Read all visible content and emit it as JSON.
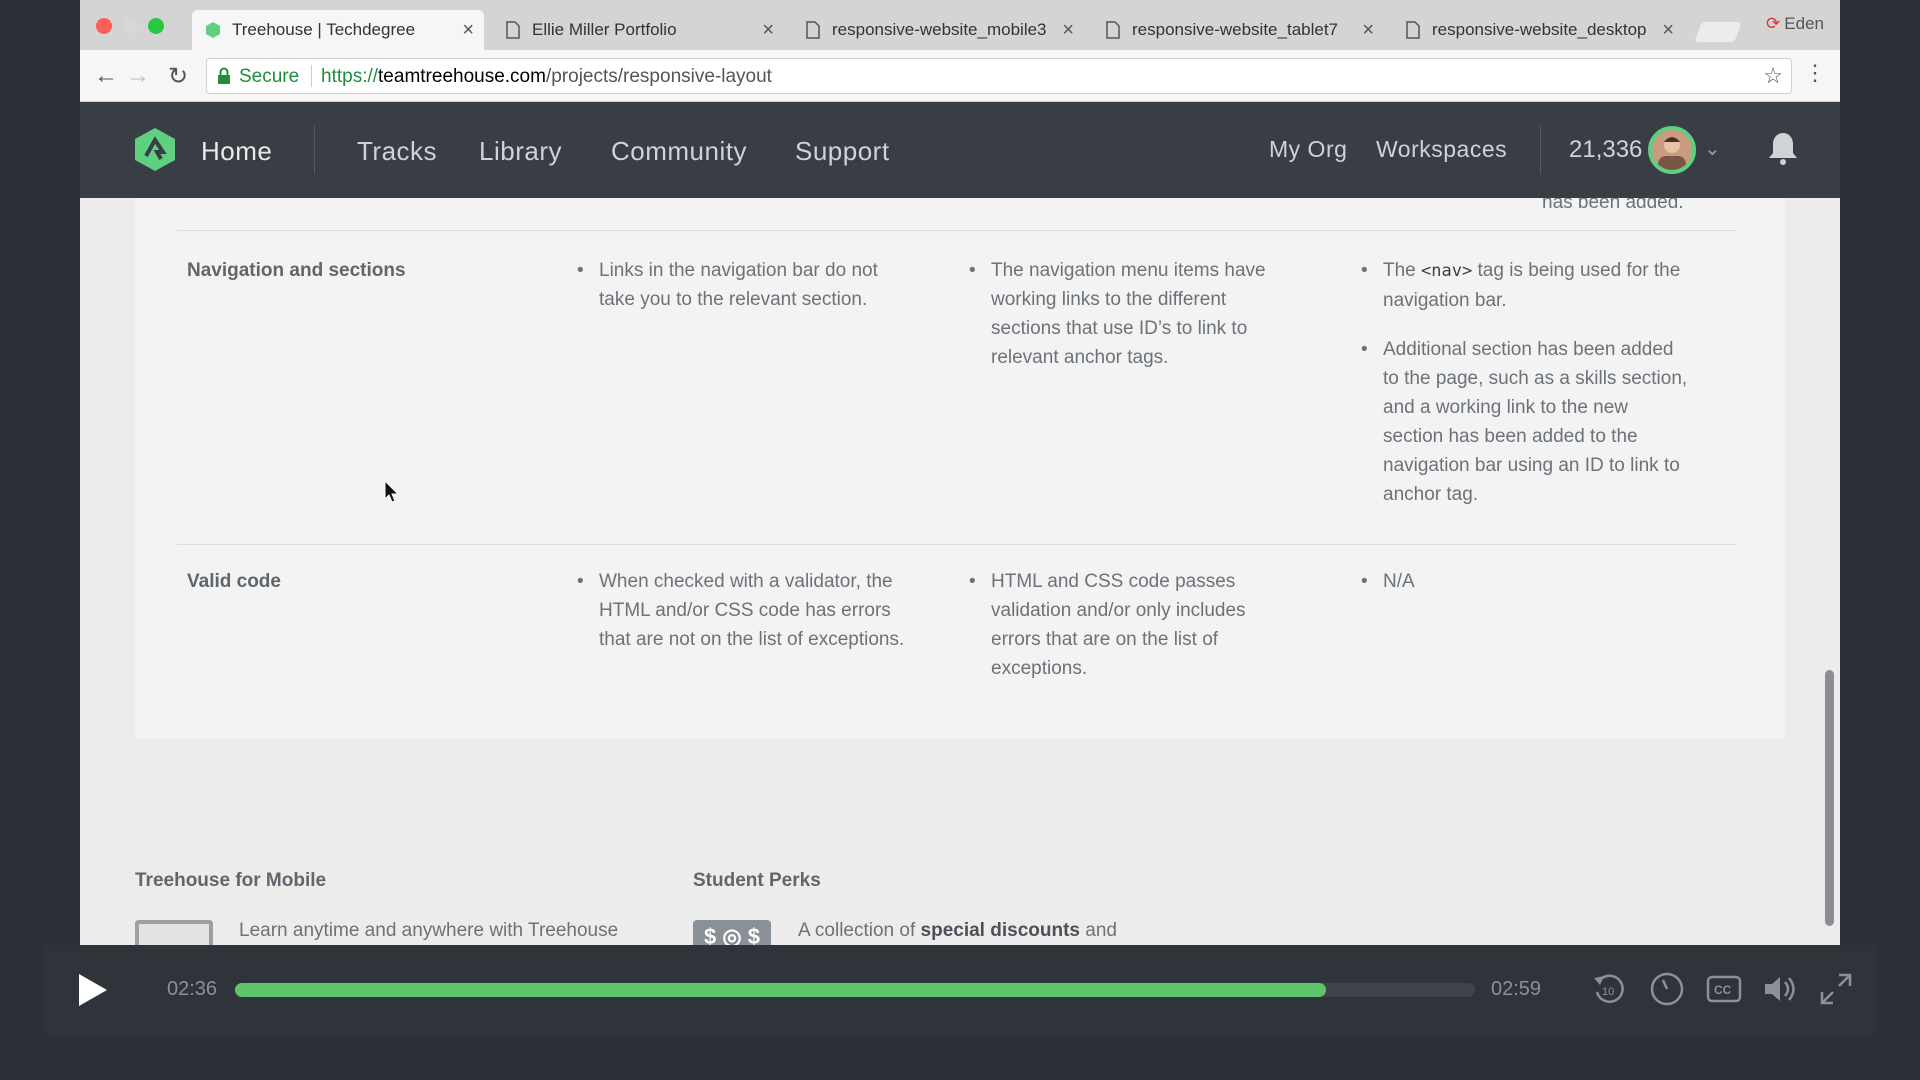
{
  "browser": {
    "tabs": [
      {
        "title": "Treehouse | Techdegree",
        "active": true
      },
      {
        "title": "Ellie Miller Portfolio",
        "active": false
      },
      {
        "title": "responsive-website_mobile3",
        "active": false
      },
      {
        "title": "responsive-website_tablet7",
        "active": false
      },
      {
        "title": "responsive-website_desktop",
        "active": false
      }
    ],
    "profile_name": "Eden",
    "address": {
      "secure_label": "Secure",
      "scheme": "https://",
      "host": "teamtreehouse.com",
      "path": "/projects/responsive-layout"
    }
  },
  "site_header": {
    "nav": {
      "home": "Home",
      "tracks": "Tracks",
      "library": "Library",
      "community": "Community",
      "support": "Support"
    },
    "right": {
      "my_org": "My Org",
      "workspaces": "Workspaces",
      "points": "21,336"
    }
  },
  "rubric": {
    "added_fragment": "has been added.",
    "rows": [
      {
        "criterion": "Navigation and sections",
        "does_not_meet": [
          "Links in the navigation bar do not take you to the relevant section."
        ],
        "meets": [
          "The navigation menu items have working links to the different sections that use ID’s to link to relevant anchor tags."
        ],
        "exceeds": [
          {
            "before": "The ",
            "code": "<nav>",
            "after": " tag is being used for the navigation bar."
          },
          {
            "before": "Additional section has been added to the page, such as a skills section, and a working link to the new section has been added to the navigation bar using an ID to link to anchor tag.",
            "code": "",
            "after": ""
          }
        ]
      },
      {
        "criterion": "Valid code",
        "does_not_meet": [
          "When checked with a validator, the HTML and/or CSS code has errors that are not on the list of exceptions."
        ],
        "meets": [
          "HTML and CSS code passes validation and/or only includes errors that are on the list of exceptions."
        ],
        "exceeds": [
          {
            "before": "N/A",
            "code": "",
            "after": ""
          }
        ]
      }
    ]
  },
  "footer": {
    "mobile": {
      "heading": "Treehouse for Mobile",
      "text": "Learn anytime and anywhere with Treehouse"
    },
    "perks": {
      "heading": "Student Perks",
      "text_before": "A collection of ",
      "text_bold": "special discounts",
      "text_after": " and",
      "badge": "$ ◎ $"
    }
  },
  "player": {
    "current_time": "02:36",
    "duration": "02:59",
    "progress": 0.88,
    "colors": {
      "progress": "#5ec56c",
      "brand": "#5fcf80"
    }
  }
}
